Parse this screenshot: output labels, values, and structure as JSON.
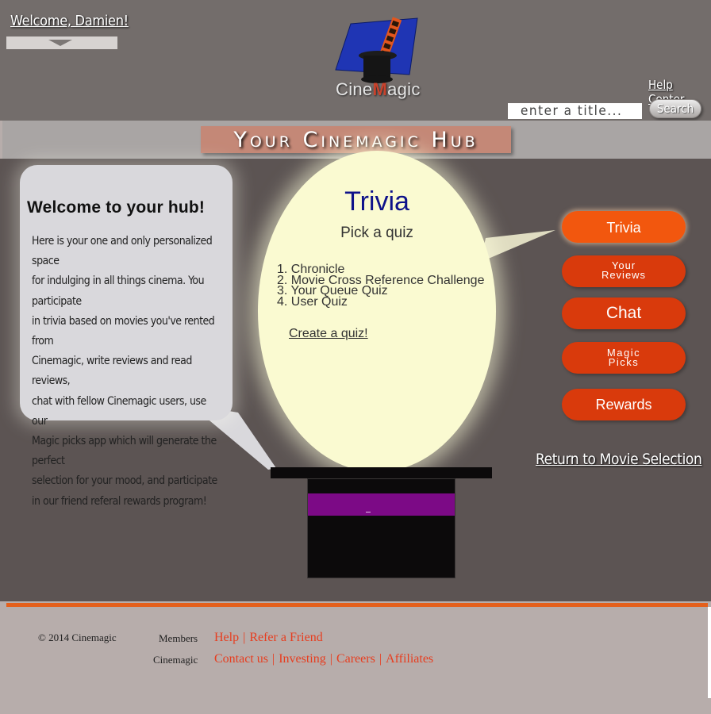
{
  "header": {
    "welcome": "Welcome, Damien!",
    "logo_text_pre": "Cine",
    "logo_text_m": "M",
    "logo_text_post": "agic",
    "help_center": "Help Center",
    "search_placeholder": "enter a title...",
    "search_button": "Search"
  },
  "hub": {
    "title": "Your Cinemagic Hub"
  },
  "bubble": {
    "title": "Welcome to your hub!",
    "lines": [
      "Here is your one and only personalized space",
      "for indulging in all things cinema. You participate",
      "in trivia based on movies you've rented from",
      "Cinemagic, write reviews and read reviews,",
      "chat with fellow Cinemagic users, use our",
      "Magic picks app which will generate the perfect",
      "selection for your mood, and participate",
      "in our friend referal rewards program!"
    ]
  },
  "trivia": {
    "title": "Trivia",
    "subtitle": "Pick a quiz",
    "quizzes": [
      "1. Chronicle",
      "2. Movie Cross Reference Challenge",
      "3. Your Queue Quiz",
      "4. User Quiz"
    ],
    "create": "Create a quiz!"
  },
  "nav": {
    "trivia": "Trivia",
    "reviews_1": "Your",
    "reviews_2": "Reviews",
    "chat": "Chat",
    "magic_1": "Magic",
    "magic_2": "Picks",
    "rewards": "Rewards"
  },
  "return_link": "Return to Movie Selection",
  "footer": {
    "copyright": "© 2014 Cinemagic",
    "members_label": "Members",
    "cinemagic_label": "Cinemagic",
    "members_links": [
      "Help",
      "Refer a Friend"
    ],
    "company_links": [
      "Contact us",
      "Investing",
      "Careers",
      "Affiliates"
    ]
  },
  "colors": {
    "header_bg": "#736d6b",
    "main_bg": "#5c5453",
    "nav_button": "#d93a0c",
    "nav_active": "#f2570e",
    "footer_link": "#e73d1f",
    "spotlight": "#fafad1",
    "hat_band": "#7c0a86"
  },
  "icons": {
    "logo": "mortarboard-tophat-filmstrip-logo",
    "dropdown": "triangle-down-icon"
  }
}
